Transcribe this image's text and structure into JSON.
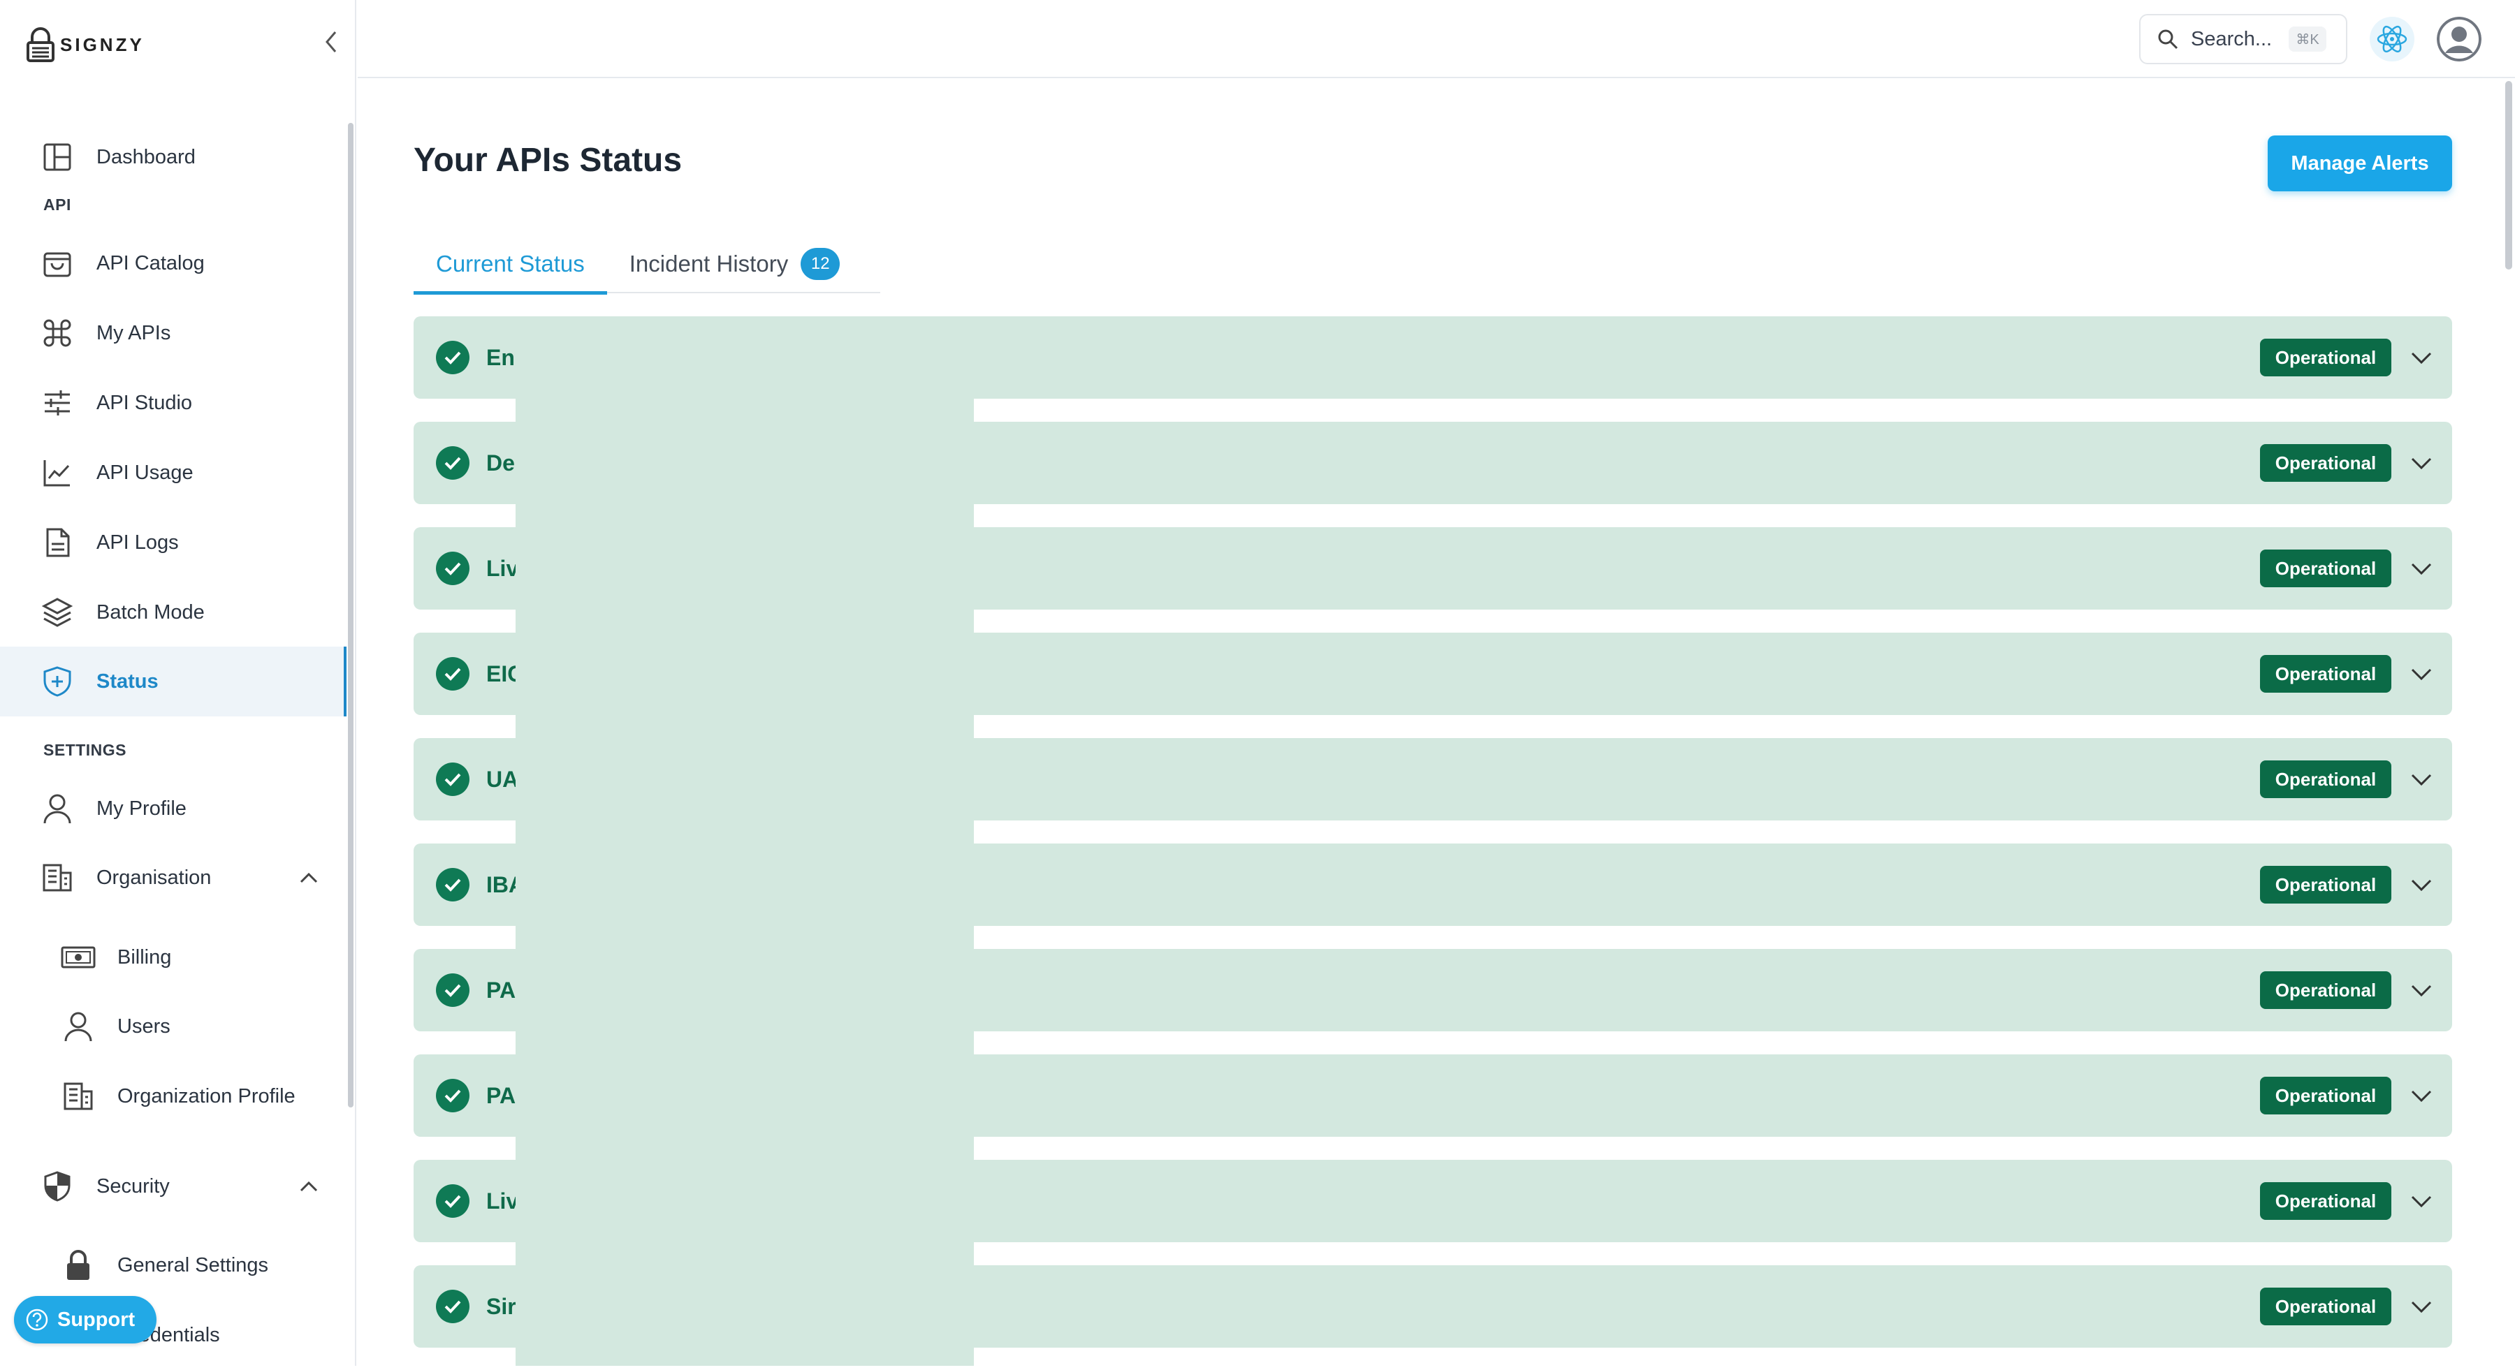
{
  "brand": {
    "logo_text": "SIGNZY"
  },
  "sidebar": {
    "items": [
      {
        "label": "Dashboard",
        "icon": "layout-icon"
      },
      {
        "label": "API Catalog",
        "icon": "bag-icon"
      },
      {
        "label": "My APIs",
        "icon": "command-icon"
      },
      {
        "label": "API Studio",
        "icon": "sliders-icon"
      },
      {
        "label": "API Usage",
        "icon": "chart-line-icon"
      },
      {
        "label": "API Logs",
        "icon": "document-icon"
      },
      {
        "label": "Batch Mode",
        "icon": "layers-icon"
      },
      {
        "label": "Status",
        "icon": "shield-plus-icon",
        "active": true
      },
      {
        "label": "My Profile",
        "icon": "user-icon"
      },
      {
        "label": "Organisation",
        "icon": "building-icon"
      },
      {
        "label": "Billing",
        "icon": "banknote-icon"
      },
      {
        "label": "Users",
        "icon": "user-icon"
      },
      {
        "label": "Organization Profile",
        "icon": "building-icon"
      },
      {
        "label": "Security",
        "icon": "shield-icon"
      },
      {
        "label": "General Settings",
        "icon": "lock-icon"
      },
      {
        "label": "Credentials",
        "icon": "key-icon"
      }
    ],
    "section_api": "API",
    "section_settings": "SETTINGS"
  },
  "support": {
    "label": "Support"
  },
  "topbar": {
    "search_placeholder": "Search...",
    "search_shortcut": "⌘K"
  },
  "main": {
    "title": "Your APIs Status",
    "manage_alerts_label": "Manage Alerts",
    "tabs": [
      {
        "label": "Current Status",
        "active": true
      },
      {
        "label": "Incident History",
        "badge": "12"
      }
    ],
    "rows": [
      {
        "name": "En",
        "status": "Operational"
      },
      {
        "name": "De",
        "status": "Operational"
      },
      {
        "name": "Liv",
        "status": "Operational"
      },
      {
        "name": "EIC",
        "status": "Operational"
      },
      {
        "name": "UA",
        "status": "Operational"
      },
      {
        "name": "IBA",
        "status": "Operational"
      },
      {
        "name": "PA",
        "status": "Operational"
      },
      {
        "name": "PA",
        "status": "Operational"
      },
      {
        "name": "Liv",
        "status": "Operational"
      },
      {
        "name": "Sir",
        "status": "Operational"
      }
    ]
  },
  "colors": {
    "accent": "#1e9ad6",
    "row_bg": "#d3e8df",
    "status_green": "#0b6b47"
  }
}
